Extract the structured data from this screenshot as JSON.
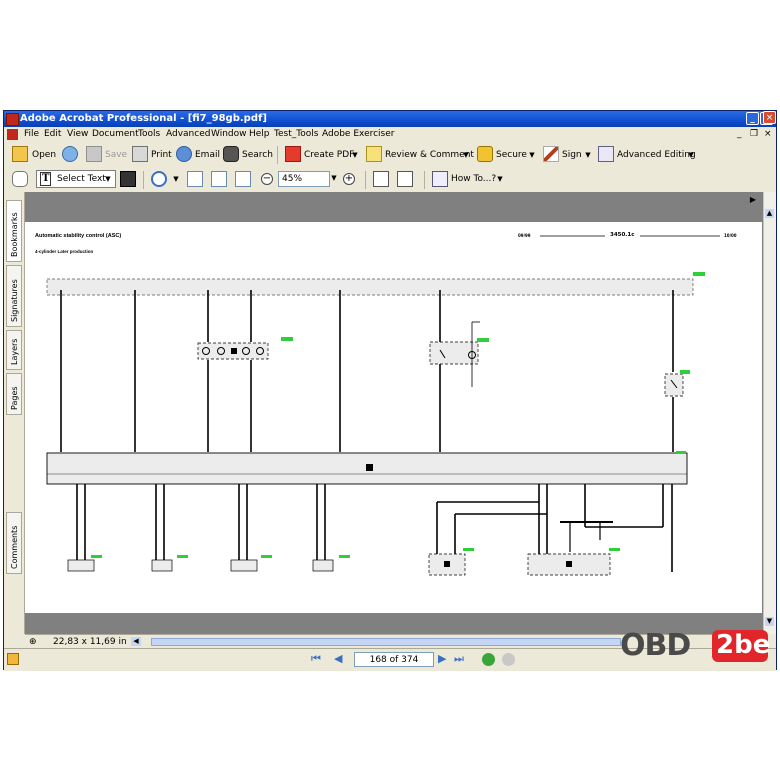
{
  "window": {
    "title": "Adobe Acrobat Professional - [fi7_98gb.pdf]"
  },
  "menu": [
    "File",
    "Edit",
    "View",
    "Document",
    "Tools",
    "Advanced",
    "Window",
    "Help",
    "Test_Tools",
    "Adobe Exerciser"
  ],
  "toolbar1": {
    "open": "Open",
    "save": "Save",
    "print": "Print",
    "email": "Email",
    "search": "Search",
    "create_pdf": "Create PDF",
    "review_comment": "Review & Comment",
    "secure": "Secure",
    "sign": "Sign",
    "advanced_editing": "Advanced Editing"
  },
  "toolbar2": {
    "select_text": "Select Text",
    "zoom": "45%",
    "how_to": "How To...?"
  },
  "sidebar_tabs": [
    "Bookmarks",
    "Signatures",
    "Layers",
    "Pages",
    "Comments"
  ],
  "document": {
    "title": "Automatic stability control (ASC)",
    "subtitle": "4-cylinder Later production",
    "ref_left": "09/99",
    "ref_code": "3450.1c",
    "ref_right": "10/00"
  },
  "status": {
    "page_size": "22,83 x 11,69 in"
  },
  "nav": {
    "page_indicator": "168 of 374"
  },
  "watermark": {
    "text_left": "OBD",
    "text_right": "2be"
  },
  "colors": {
    "title_bar": "#0f4fd1",
    "chrome": "#ece9d8",
    "doc_bg": "#808080",
    "green_tag": "#2fcf3a",
    "watermark_red": "#e0262a"
  }
}
